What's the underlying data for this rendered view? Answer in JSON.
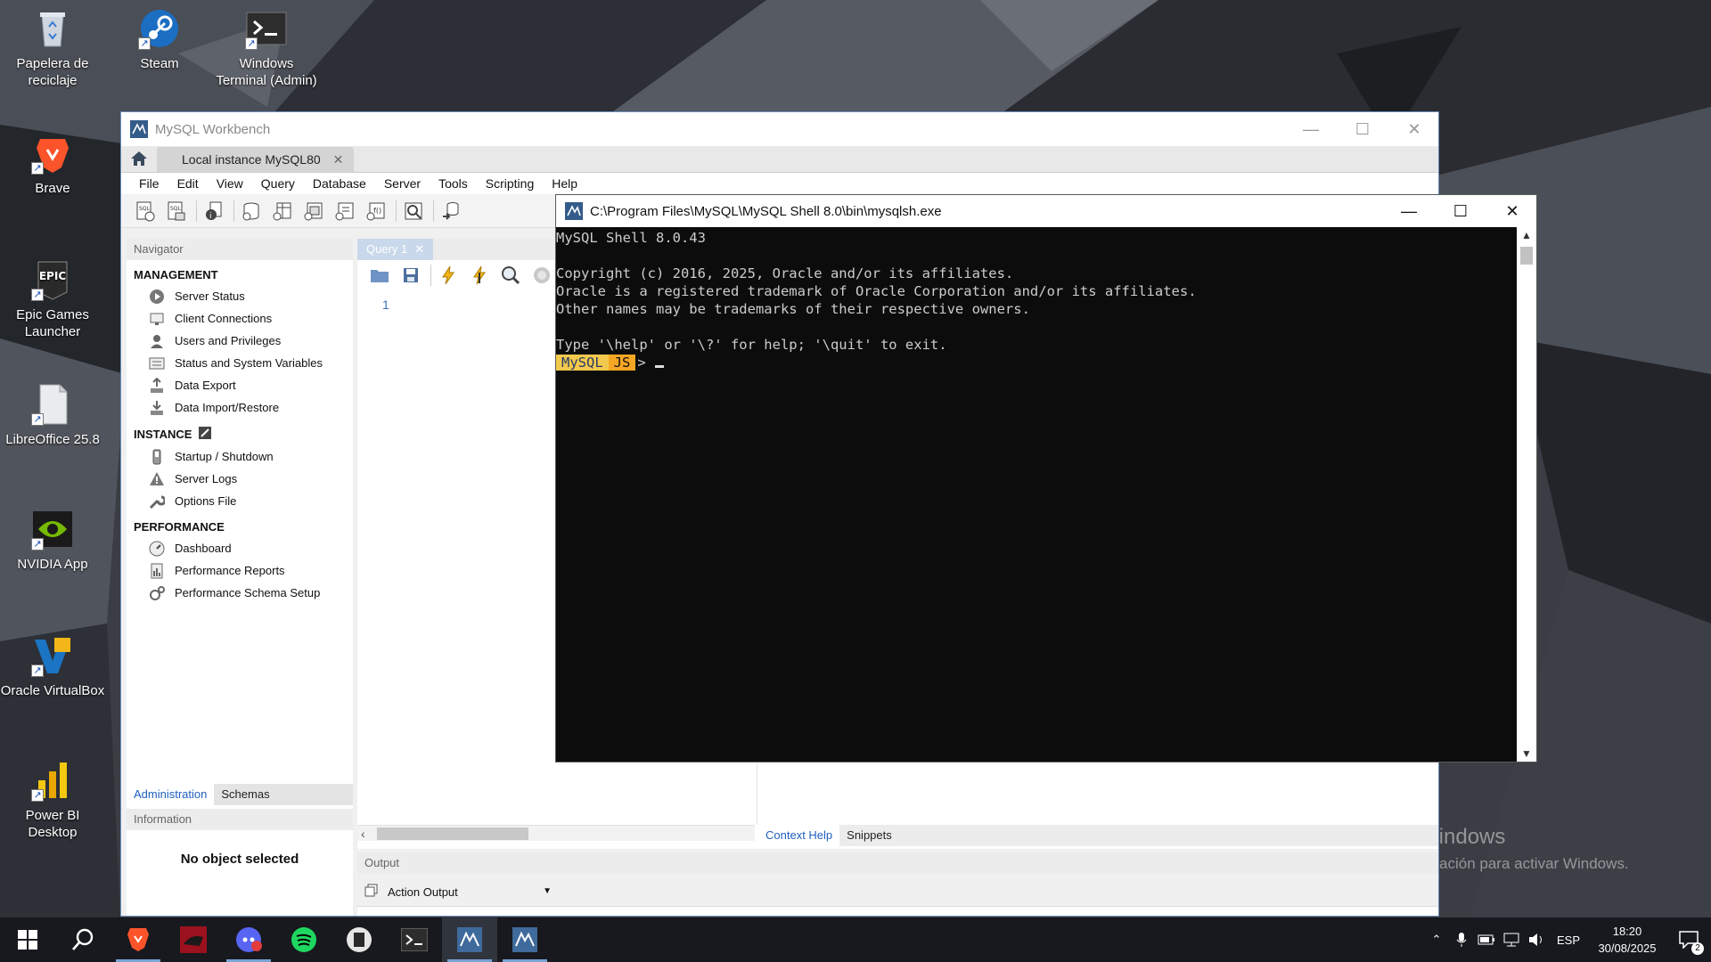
{
  "desktop": {
    "icons": [
      {
        "label": "Papelera de reciclaje",
        "icon": "recycle-bin-icon"
      },
      {
        "label": "Steam",
        "icon": "steam-icon"
      },
      {
        "label": "Windows Terminal (Admin)",
        "icon": "terminal-icon"
      },
      {
        "label": "Brave",
        "icon": "brave-icon"
      },
      {
        "label": "Epic Games Launcher",
        "icon": "epic-games-icon"
      },
      {
        "label": "LibreOffice 25.8",
        "icon": "libreoffice-icon"
      },
      {
        "label": "NVIDIA App",
        "icon": "nvidia-icon"
      },
      {
        "label": "Oracle VirtualBox",
        "icon": "virtualbox-icon"
      },
      {
        "label": "Power BI Desktop",
        "icon": "power-bi-icon"
      }
    ],
    "activate_title": "Activar Windows",
    "activate_sub": "Ve a Configuración para activar Windows."
  },
  "workbench": {
    "title": "MySQL Workbench",
    "connection_tab": "Local instance MySQL80",
    "menu": [
      "File",
      "Edit",
      "View",
      "Query",
      "Database",
      "Server",
      "Tools",
      "Scripting",
      "Help"
    ],
    "navigator": {
      "header": "Navigator",
      "management_title": "MANAGEMENT",
      "management": [
        "Server Status",
        "Client Connections",
        "Users and Privileges",
        "Status and System Variables",
        "Data Export",
        "Data Import/Restore"
      ],
      "instance_title": "INSTANCE",
      "instance": [
        "Startup / Shutdown",
        "Server Logs",
        "Options File"
      ],
      "performance_title": "PERFORMANCE",
      "performance": [
        "Dashboard",
        "Performance Reports",
        "Performance Schema Setup"
      ],
      "tabs": [
        "Administration",
        "Schemas"
      ],
      "info_header": "Information",
      "no_object": "No object selected"
    },
    "query_tab": "Query 1",
    "line_number": "1",
    "side_tabs": [
      "Context Help",
      "Snippets"
    ],
    "output_header": "Output",
    "output_select": "Action Output"
  },
  "shell": {
    "title": "C:\\Program Files\\MySQL\\MySQL Shell 8.0\\bin\\mysqlsh.exe",
    "lines": [
      "MySQL Shell 8.0.43",
      "",
      "Copyright (c) 2016, 2025, Oracle and/or its affiliates.",
      "Oracle is a registered trademark of Oracle Corporation and/or its affiliates.",
      "Other names may be trademarks of their respective owners.",
      "",
      "Type '\\help' or '\\?' for help; '\\quit' to exit."
    ],
    "prompt_label": "MySQL",
    "prompt_mode": "JS",
    "prompt_arrow": ">"
  },
  "taskbar": {
    "apps": [
      "start-icon",
      "search-icon",
      "brave-icon",
      "game-app-icon",
      "discord-icon",
      "spotify-icon",
      "libreoffice-icon",
      "terminal-icon",
      "mysql-workbench-icon",
      "mysql-shell-icon"
    ],
    "language": "ESP",
    "time": "18:20",
    "date": "30/08/2025",
    "notification_count": "2"
  },
  "colors": {
    "prompt_bg": "#f2c94c",
    "prompt_mode_bg": "#f5a623",
    "accent": "#2060c0"
  }
}
